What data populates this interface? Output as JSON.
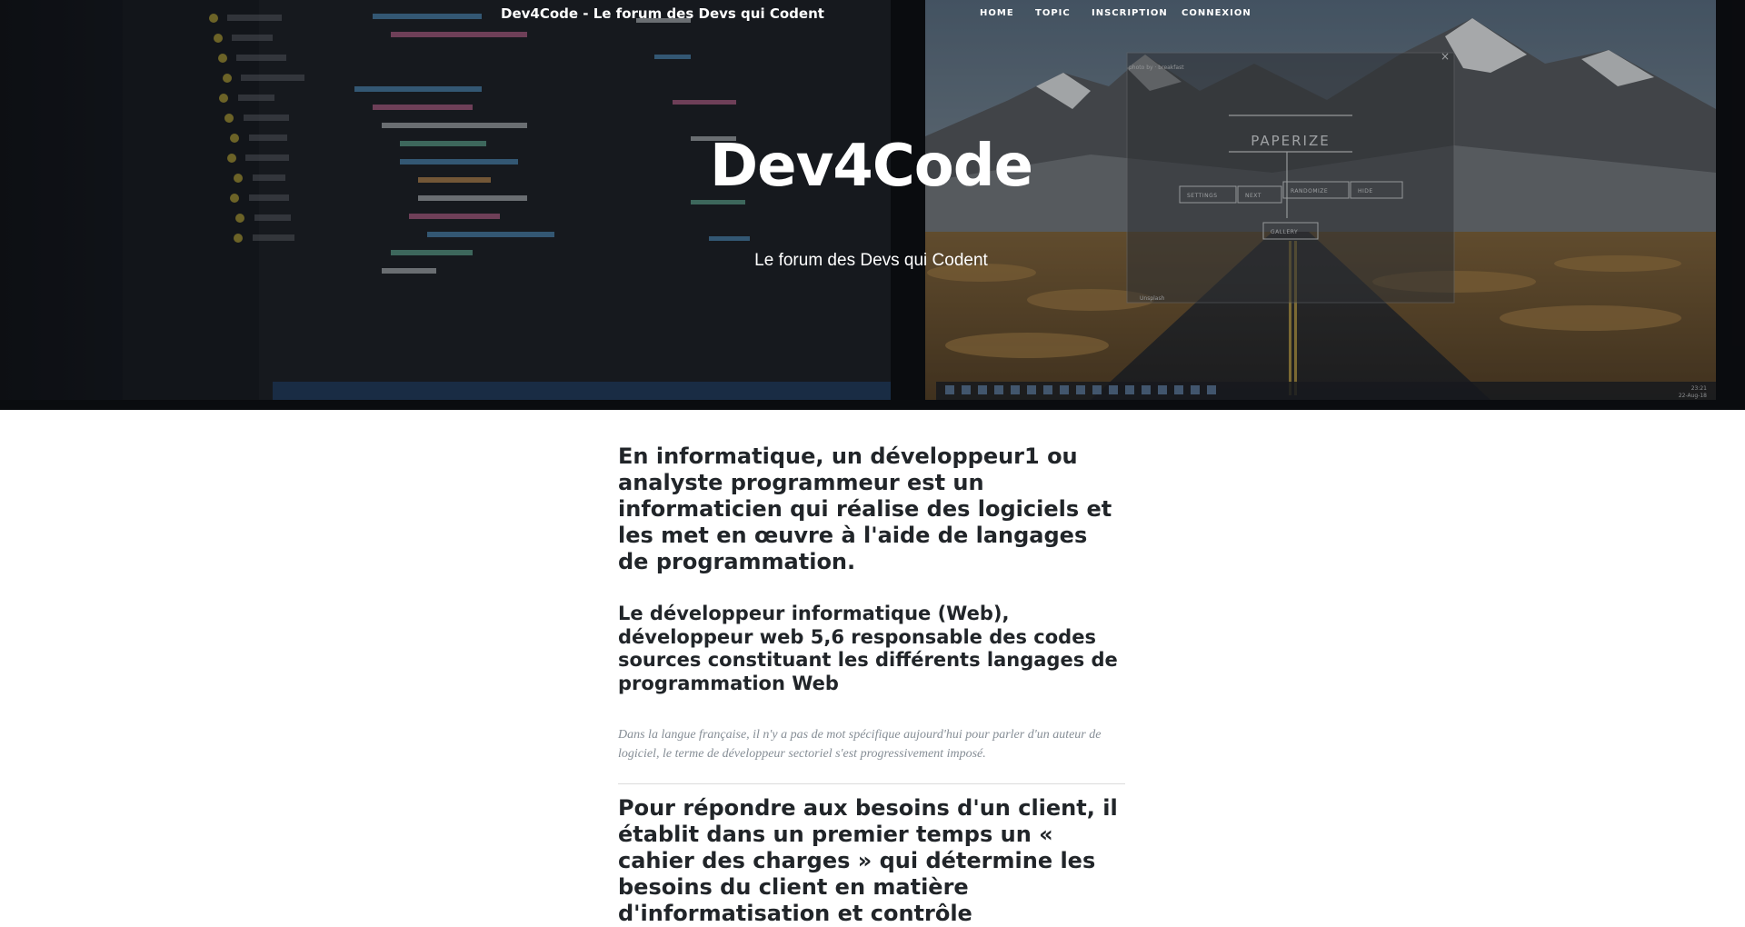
{
  "nav": {
    "brand": "Dev4Code - Le forum des Devs qui Codent",
    "links": [
      {
        "label": "HOME"
      },
      {
        "label": "TOPIC"
      },
      {
        "label": "INSCRIPTION"
      },
      {
        "label": "CONNEXION"
      }
    ]
  },
  "hero": {
    "title": "Dev4Code",
    "subtitle": "Le forum des Devs qui Codent",
    "photo": {
      "screen_logo": "PAPERIZE",
      "screen_buttons": [
        "SETTINGS",
        "NEXT",
        "RANDOMIZE",
        "HIDE",
        "GALLERY"
      ],
      "screen_credit": "Unsplash",
      "clock_time": "23:21",
      "clock_date": "22-Aug-18"
    }
  },
  "article": {
    "lead_heading": "En informatique, un développeur1 ou analyste programmeur est un informaticien qui réalise des logiciels et les met en œuvre à l'aide de langages de programmation.",
    "second_heading": "Le développeur informatique (Web), développeur web 5,6 responsable des codes sources constituant les différents langages de programmation Web",
    "meta": "Dans la langue française, il n'y a pas de mot spécifique aujourd'hui pour parler d'un auteur de logiciel, le terme de développeur sectoriel s'est progressivement imposé.",
    "third_heading": "Pour répondre aux besoins d'un client, il établit dans un premier temps un « cahier des charges » qui détermine les besoins du client en matière d'informatisation et contrôle"
  }
}
